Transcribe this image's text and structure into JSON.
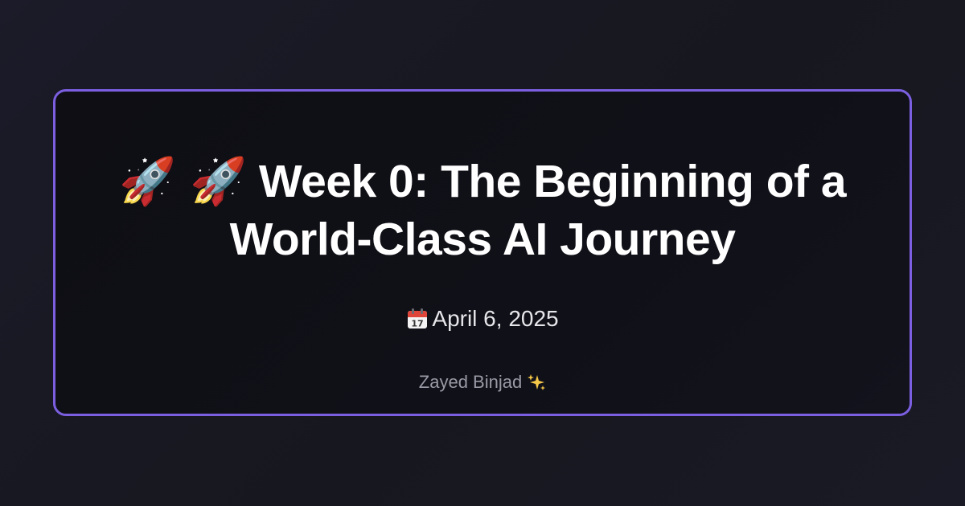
{
  "post": {
    "title_emoji": "🚀 🚀",
    "title_text": "Week 0: The Beginning of a World-Class AI Journey",
    "date": "April 6, 2025",
    "author": "Zayed Binjad"
  },
  "icons": {
    "title": [
      "rocket-icon",
      "rocket-icon"
    ],
    "date": "calendar-icon",
    "author": "sparkles-icon"
  },
  "colors": {
    "accent_border": "#7b5fe0",
    "title": "#ffffff",
    "date": "#e6e6ea",
    "author": "#9a9aa6"
  }
}
